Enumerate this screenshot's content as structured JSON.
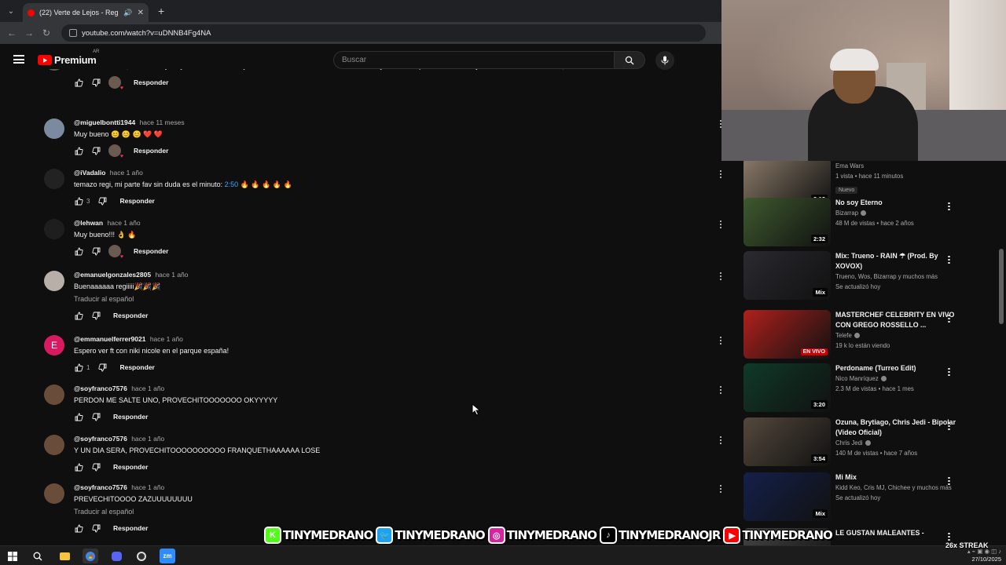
{
  "browser": {
    "tab_title": "(22) Verte de Lejos - Regin...",
    "address": "youtube.com/watch?v=uDNNB4Fg4NA"
  },
  "header": {
    "logo_text": "Premium",
    "region": "AR",
    "search_placeholder": "Buscar"
  },
  "comments": [
    {
      "author": "",
      "time": "",
      "text": "Vas a tener éxito, buena voz y muy buen tema. Consejo al cantar trata de no hacerlo tan robótico y trata de expresar tu voz real y canta con todo el corazón, eso hace la diferencia",
      "likes": "",
      "translate": "",
      "reply": "Responder",
      "avatar_letter": "",
      "avatar_color": "#5a5e4f",
      "heart": true
    },
    {
      "author": "@miguelbontti1944",
      "time": "hace 11 meses",
      "text": "Muy bueno 😊 😊 😊 ❤️ ❤️",
      "likes": "",
      "translate": "",
      "reply": "Responder",
      "avatar_letter": "",
      "avatar_color": "#7c8aa0",
      "heart": true
    },
    {
      "author": "@iVadalio",
      "time": "hace 1 año",
      "text_pre": "temazo regi, mi parte fav sin duda es el minuto: ",
      "timestamp": "2:50",
      "text_post": " 🔥 🔥 🔥 🔥 🔥",
      "likes": "3",
      "translate": "",
      "reply": "Responder",
      "avatar_letter": "",
      "avatar_color": "#222222",
      "heart": false
    },
    {
      "author": "@lehwan",
      "time": "hace 1 año",
      "text": "Muy bueno!!! 👌 🔥",
      "likes": "",
      "translate": "",
      "reply": "Responder",
      "avatar_letter": "",
      "avatar_color": "#1e1e1e",
      "heart": true
    },
    {
      "author": "@emanuelgonzales2805",
      "time": "hace 1 año",
      "text": "Buenaaaaaa regiiiii🎉🎉🎉",
      "likes": "",
      "translate": "Traducir al español",
      "reply": "Responder",
      "avatar_letter": "",
      "avatar_color": "#b8b0a8",
      "heart": false
    },
    {
      "author": "@emmanuelferrer9021",
      "time": "hace 1 año",
      "text": "Espero ver ft con niki nicole en el parque españa!",
      "likes": "1",
      "translate": "",
      "reply": "Responder",
      "avatar_letter": "E",
      "avatar_color": "#d81b60",
      "heart": false
    },
    {
      "author": "@soyfranco7576",
      "time": "hace 1 año",
      "text": "PERDON ME SALTE UNO, PROVECHITOOOOOOO OKYYYYY",
      "likes": "",
      "translate": "",
      "reply": "Responder",
      "avatar_letter": "",
      "avatar_color": "#6a4c3a",
      "heart": false
    },
    {
      "author": "@soyfranco7576",
      "time": "hace 1 año",
      "text": "Y UN DIA SERA, PROVECHITOOOOOOOOOO FRANQUETHAAAAAA LOSE",
      "likes": "",
      "translate": "",
      "reply": "Responder",
      "avatar_letter": "",
      "avatar_color": "#6a4c3a",
      "heart": false
    },
    {
      "author": "@soyfranco7576",
      "time": "hace 1 año",
      "text": "PREVECHITOOOO ZAZUUUUUUUU",
      "likes": "",
      "translate": "Traducir al español",
      "reply": "Responder",
      "avatar_letter": "",
      "avatar_color": "#6a4c3a",
      "heart": false
    }
  ],
  "sidebar": {
    "videos": [
      {
        "title": "",
        "channel": "Ema Wars",
        "meta": "1 vista • hace 11 minutos",
        "badge": "Nuevo",
        "duration": "3:13",
        "live": "",
        "thumb": "#8a7a68",
        "verified": false
      },
      {
        "title": "No soy Eterno",
        "channel": "Bizarrap",
        "meta": "48 M de vistas • hace 2 años",
        "badge": "",
        "duration": "2:32",
        "live": "",
        "thumb": "#3e5a2e",
        "verified": true
      },
      {
        "title": "Mix: Trueno - RAIN ☂ (Prod. By XOVOX)",
        "channel": "Trueno, Wos, Bizarrap y muchos más",
        "meta": "Se actualizó hoy",
        "badge": "",
        "duration": "Mix",
        "live": "",
        "thumb": "#2a2a30",
        "verified": false
      },
      {
        "title": "MASTERCHEF CELEBRITY  EN VIVO CON GREGO ROSSELLO ...",
        "channel": "Telefe",
        "meta": "19 k lo están viendo",
        "badge": "",
        "duration": "",
        "live": "EN VIVO",
        "thumb": "#b0201c",
        "verified": true
      },
      {
        "title": "Perdoname (Turreo Edit)",
        "channel": "Nico Manríquez",
        "meta": "2.3 M de vistas • hace 1 mes",
        "badge": "",
        "duration": "3:20",
        "live": "",
        "thumb": "#0f3a28",
        "verified": true
      },
      {
        "title": "Ozuna, Brytiago, Chris Jedi - Bipolar (Video Oficial)",
        "channel": "Chris Jedi",
        "meta": "140 M de vistas • hace 7 años",
        "badge": "",
        "duration": "3:54",
        "live": "",
        "thumb": "#54483c",
        "verified": true
      },
      {
        "title": "Mi Mix",
        "channel": "Kidd Keo, Cris MJ, Chichee y muchos más",
        "meta": "Se actualizó hoy",
        "badge": "",
        "duration": "Mix",
        "live": "",
        "thumb": "#14204a",
        "verified": false
      },
      {
        "title": "LE GUSTAN MALEANTES -",
        "channel": "",
        "meta": "",
        "badge": "",
        "duration": "",
        "live": "",
        "thumb": "#444444",
        "verified": false
      }
    ]
  },
  "overlay": {
    "socials": [
      {
        "handle": "TINYMEDRANO",
        "icon": "kick-icon",
        "color": "#53fc18",
        "glyph": "K"
      },
      {
        "handle": "TINYMEDRANO",
        "icon": "twitter-icon",
        "color": "#1da1f2",
        "glyph": "🐦"
      },
      {
        "handle": "TINYMEDRANO",
        "icon": "instagram-icon",
        "color": "#d6249f",
        "glyph": "◎"
      },
      {
        "handle": "TINYMEDRANOJR",
        "icon": "tiktok-icon",
        "color": "#000000",
        "glyph": "♪"
      },
      {
        "handle": "TINYMEDRANO",
        "icon": "youtube-icon",
        "color": "#ff0000",
        "glyph": "▶"
      }
    ],
    "streak": "26x STREAK"
  },
  "taskbar": {
    "date": "27/10/2025"
  }
}
